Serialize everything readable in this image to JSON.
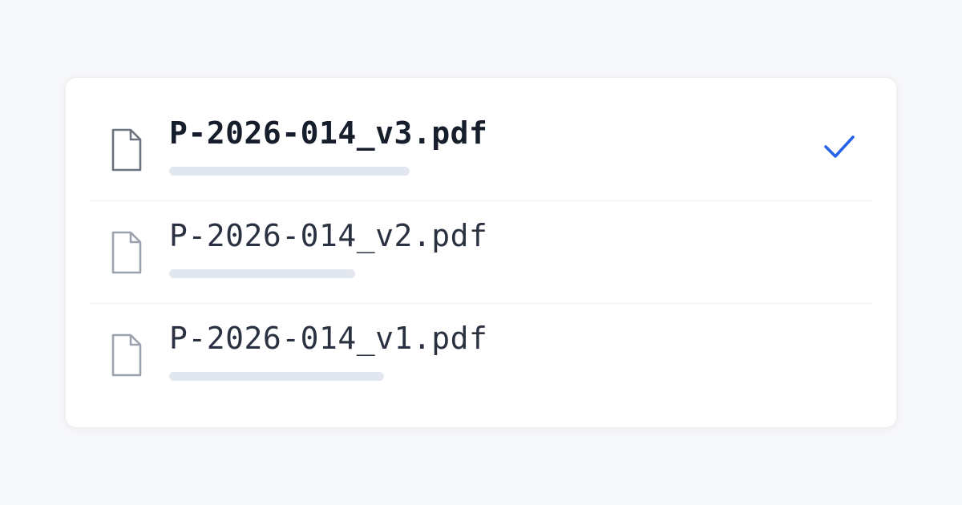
{
  "file_list": {
    "items": [
      {
        "name": "P-2026-014_v3.pdf",
        "selected": true,
        "icon": "document-icon",
        "meta_fill": 0.58
      },
      {
        "name": "P-2026-014_v2.pdf",
        "selected": false,
        "icon": "document-icon",
        "meta_fill": 0.45
      },
      {
        "name": "P-2026-014_v1.pdf",
        "selected": false,
        "icon": "document-icon",
        "meta_fill": 0.52
      }
    ],
    "selected_indicator_icon": "checkmark-icon"
  },
  "colors": {
    "page_background": "#f7f8fa",
    "card_background": "#ffffff",
    "accent": "#2563eb",
    "text_primary": "#161d2b",
    "text_secondary": "#2a3242",
    "placeholder_bar": "#e2e7ef"
  }
}
